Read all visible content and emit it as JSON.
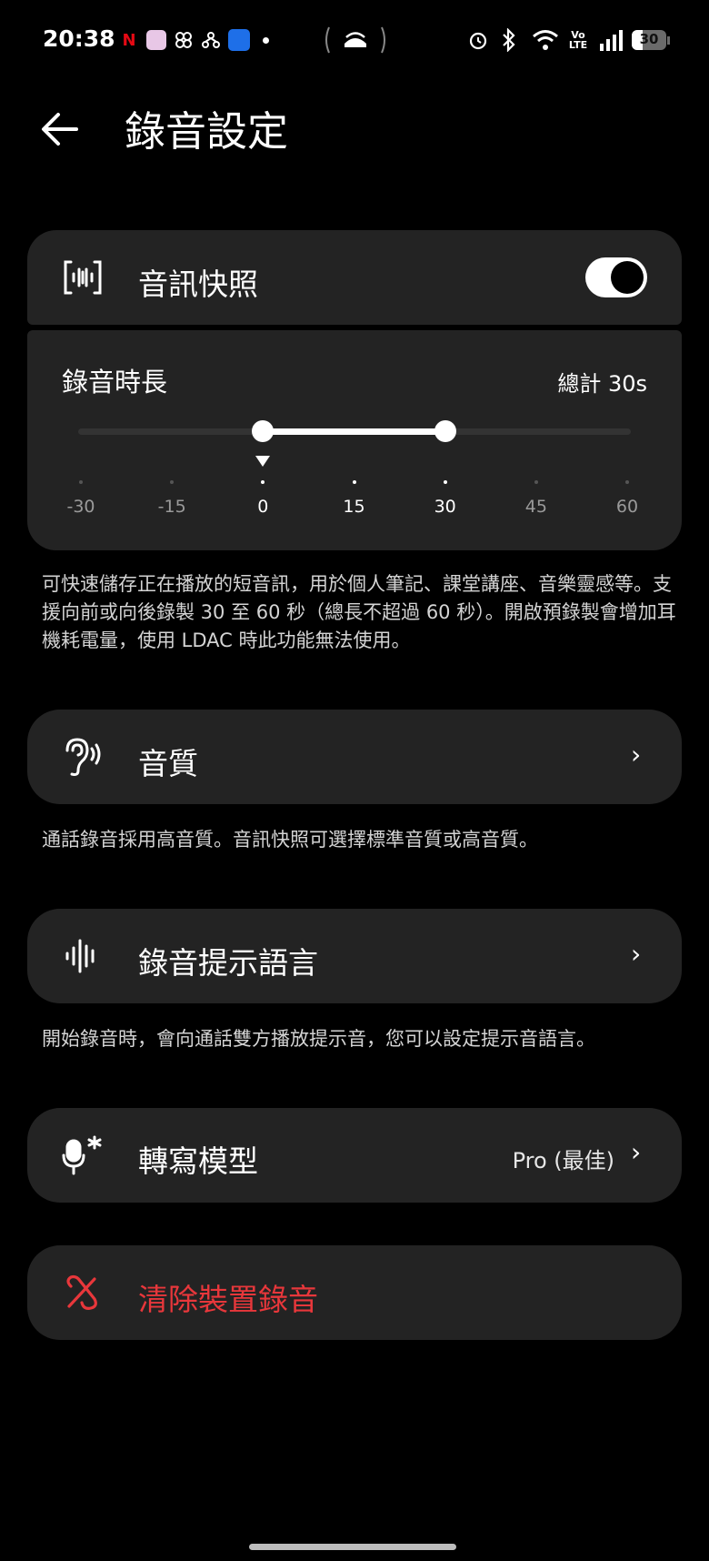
{
  "status_bar": {
    "time": "20:38",
    "battery": "30",
    "network_label": "Vo LTE",
    "icons": [
      "netflix-icon",
      "avatar-app-icon",
      "pinwheel-icon",
      "network-app-icon",
      "wifi-app-icon",
      "dot-icon",
      "hotspot-icon",
      "alarm-icon",
      "bluetooth-icon",
      "wifi-icon",
      "signal-icon",
      "battery-icon"
    ]
  },
  "header": {
    "title": "錄音設定"
  },
  "audio_snapshot": {
    "label": "音訊快照",
    "toggle_on": true
  },
  "recording_length": {
    "label": "錄音時長",
    "total": "總計 30s",
    "range_start": 0,
    "range_end": 30,
    "ticks": [
      "-30",
      "-15",
      "0",
      "15",
      "30",
      "45",
      "60"
    ]
  },
  "snapshot_note": "可快速儲存正在播放的短音訊，用於個人筆記、課堂講座、音樂靈感等。支援向前或向後錄製 30 至 60 秒（總長不超過 60 秒）。開啟預錄製會增加耳機耗電量，使用 LDAC 時此功能無法使用。",
  "quality": {
    "label": "音質"
  },
  "quality_note": "通話錄音採用高音質。音訊快照可選擇標準音質或高音質。",
  "prompt_language": {
    "label": "錄音提示語言"
  },
  "prompt_note": "開始錄音時，會向通話雙方播放提示音，您可以設定提示音語言。",
  "transcription_model": {
    "label": "轉寫模型",
    "value": "Pro (最佳)"
  },
  "clear_recordings": {
    "label": "清除裝置錄音",
    "color": "#e8373b"
  }
}
